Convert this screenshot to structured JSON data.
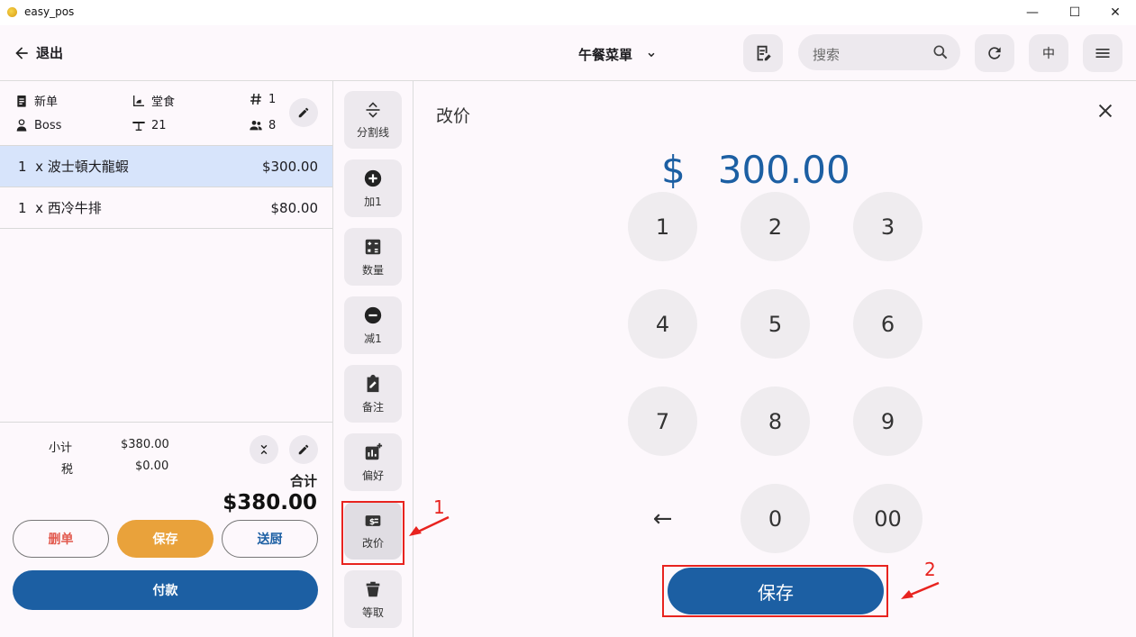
{
  "window": {
    "title": "easy_pos",
    "minimize": "—",
    "maximize": "☐",
    "close": "✕"
  },
  "appbar": {
    "back_label": "退出",
    "menu_name": "午餐菜單",
    "search_placeholder": "搜索",
    "language": "中"
  },
  "order_info": {
    "status": "新单",
    "dining_mode": "堂食",
    "order_number": "1",
    "staff": "Boss",
    "table": "21",
    "guests": "8"
  },
  "order_items": [
    {
      "qty": "1",
      "x": "x",
      "name": "波士頓大龍蝦",
      "price": "$300.00"
    },
    {
      "qty": "1",
      "x": "x",
      "name": "西冷牛排",
      "price": "$80.00"
    }
  ],
  "summary": {
    "subtotal_label": "小计",
    "subtotal_value": "$380.00",
    "tax_label": "税",
    "tax_value": "$0.00",
    "total_label": "合计",
    "total_value": "$380.00"
  },
  "actions": {
    "delete": "删单",
    "save": "保存",
    "send_kitchen": "送厨",
    "pay": "付款"
  },
  "tools": [
    {
      "icon": "divider-icon",
      "label": "分割线"
    },
    {
      "icon": "plus-circle-icon",
      "label": "加1"
    },
    {
      "icon": "calculator-icon",
      "label": "数量"
    },
    {
      "icon": "minus-circle-icon",
      "label": "减1"
    },
    {
      "icon": "clipboard-edit-icon",
      "label": "备注"
    },
    {
      "icon": "chart-plus-icon",
      "label": "偏好"
    },
    {
      "icon": "price-tag-icon",
      "label": "改价"
    },
    {
      "icon": "takeaway-icon",
      "label": "等取"
    }
  ],
  "price_dialog": {
    "title": "改价",
    "currency": "$",
    "amount": "300.00",
    "keys": [
      "1",
      "2",
      "3",
      "4",
      "5",
      "6",
      "7",
      "8",
      "9",
      "←",
      "0",
      "00"
    ],
    "save_label": "保存"
  },
  "annotations": {
    "first": "1",
    "second": "2"
  },
  "colors": {
    "primary": "#1c5fa3",
    "accent": "#e9a23b",
    "danger": "#e25a4e",
    "selected_row": "#d7e4fb",
    "annotation": "#e8231f"
  }
}
